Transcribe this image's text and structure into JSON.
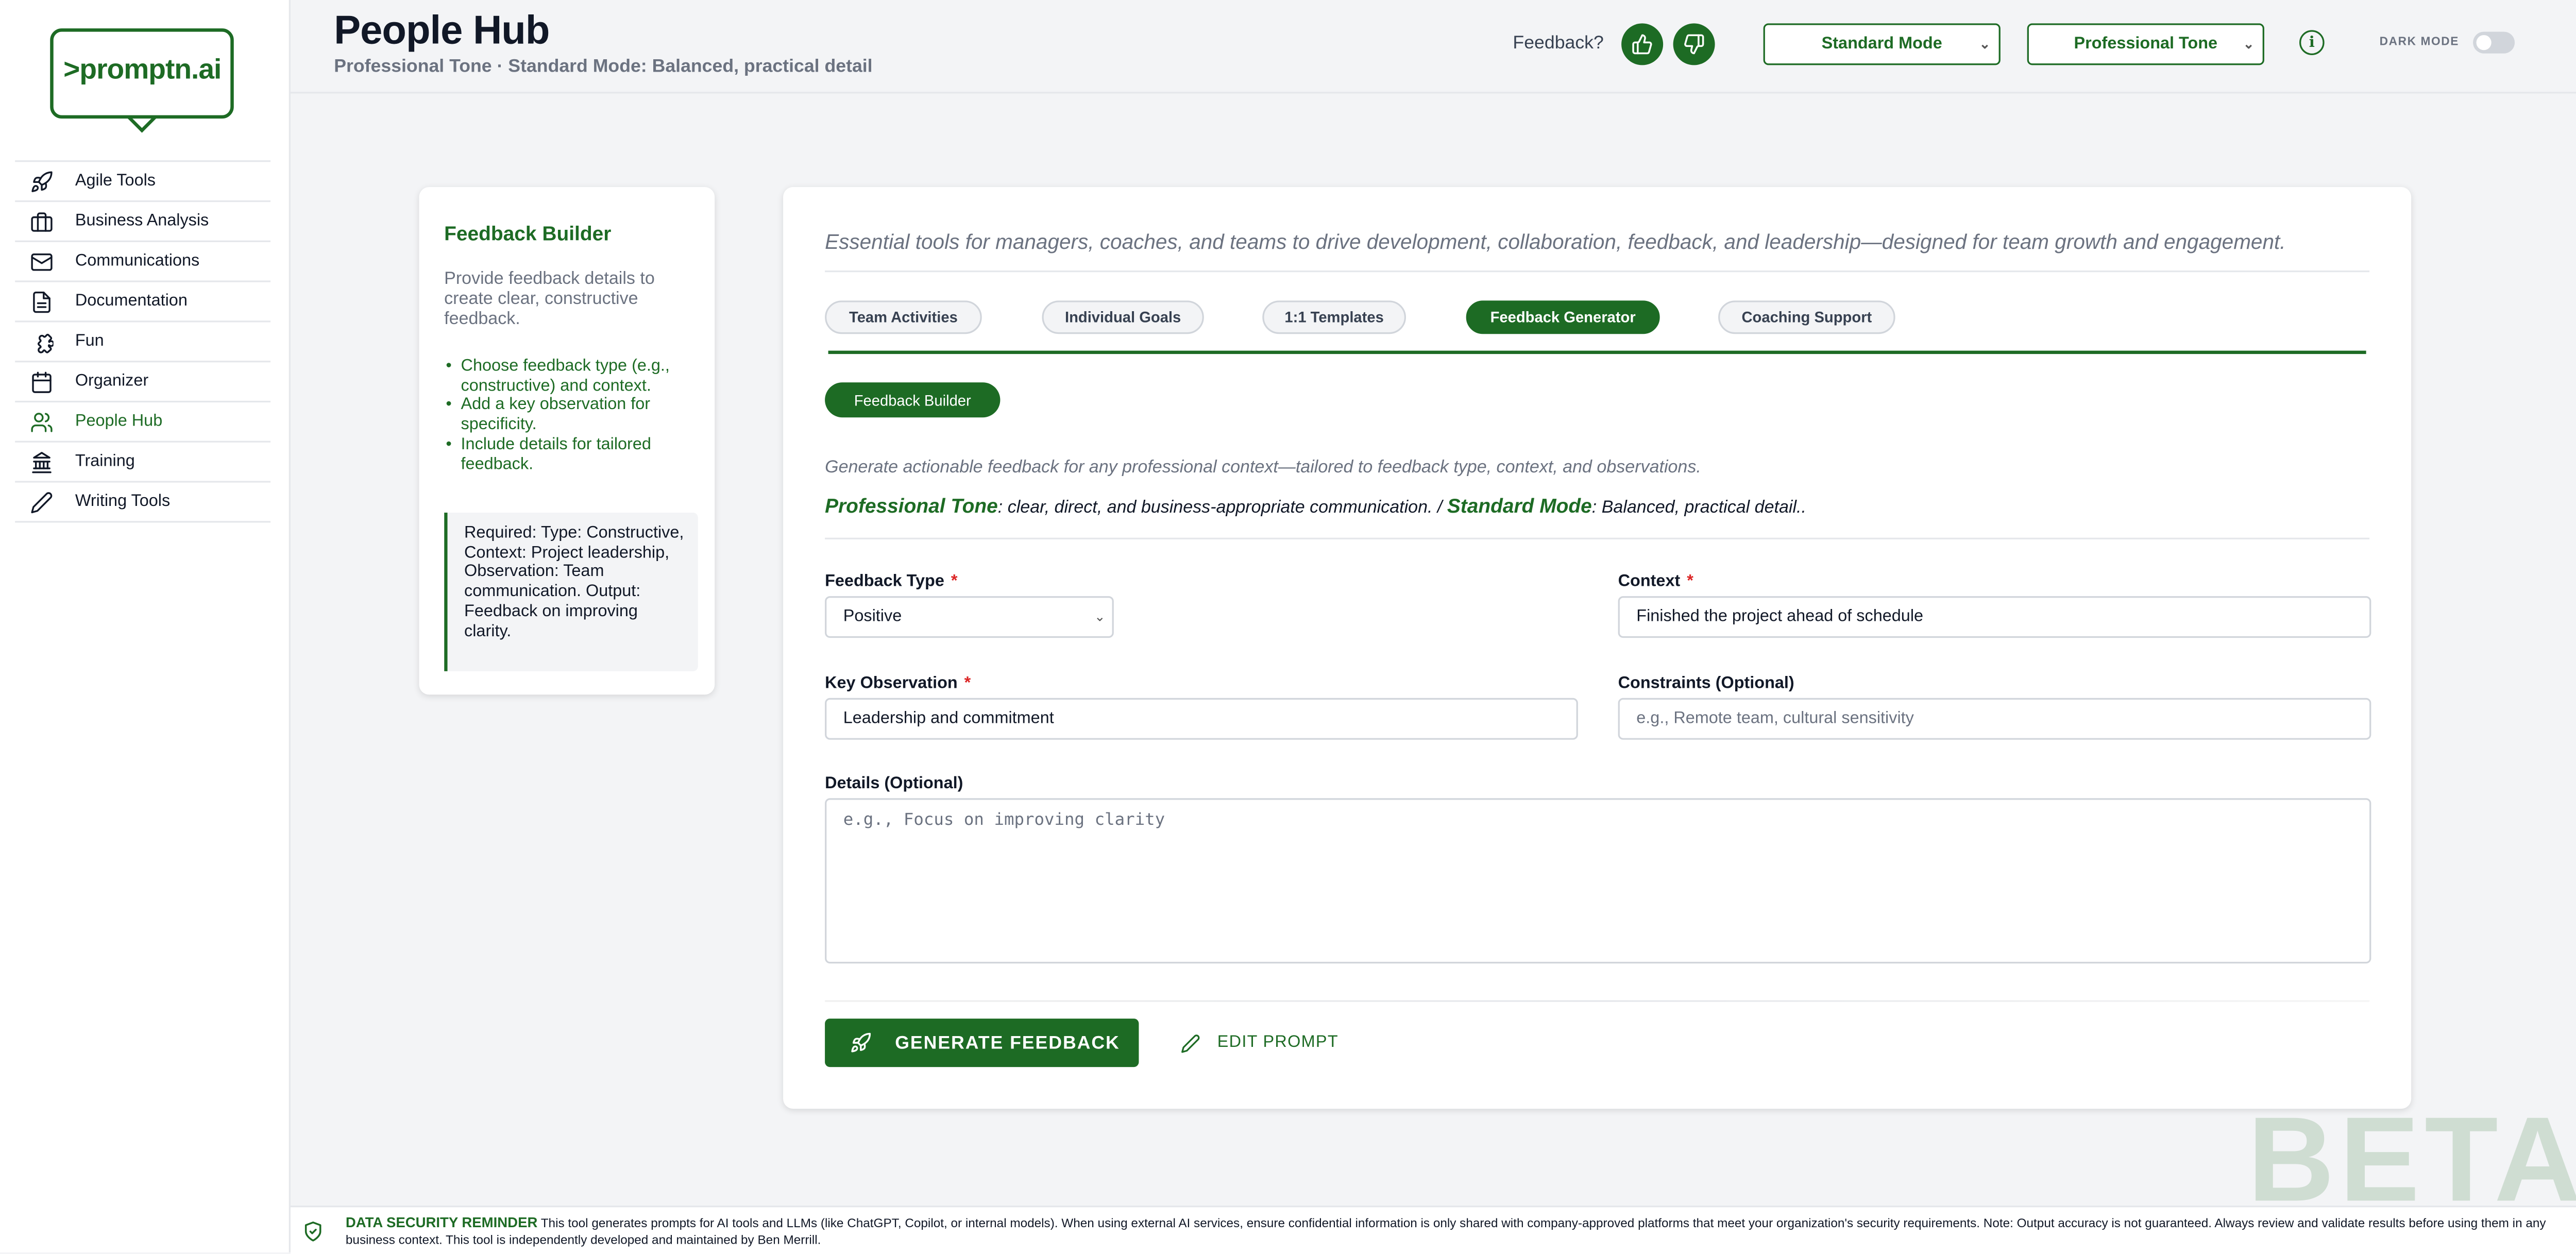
{
  "app": {
    "logo_text": "promptn.ai",
    "page_title": "People Hub",
    "page_subtitle": "Professional Tone · Standard Mode: Balanced, practical detail"
  },
  "sidebar": {
    "items": [
      {
        "label": "Agile Tools",
        "icon": "rocket-icon"
      },
      {
        "label": "Business Analysis",
        "icon": "briefcase-icon"
      },
      {
        "label": "Communications",
        "icon": "mail-icon"
      },
      {
        "label": "Documentation",
        "icon": "document-icon"
      },
      {
        "label": "Fun",
        "icon": "puzzle-icon"
      },
      {
        "label": "Organizer",
        "icon": "calendar-icon"
      },
      {
        "label": "People Hub",
        "icon": "users-icon",
        "active": true
      },
      {
        "label": "Training",
        "icon": "institution-icon"
      },
      {
        "label": "Writing Tools",
        "icon": "pencil-icon"
      }
    ]
  },
  "header": {
    "feedback_label": "Feedback?",
    "mode_select": "Standard Mode",
    "tone_select": "Professional Tone",
    "info_glyph": "i",
    "dark_mode_label": "DARK MODE",
    "dark_mode_on": false
  },
  "info_card": {
    "title": "Feedback Builder",
    "description": "Provide feedback details to create clear, constructive feedback.",
    "bullets": [
      "Choose feedback type (e.g., constructive) and context.",
      "Add a key observation for specificity.",
      "Include details for tailored feedback."
    ],
    "required_note": "Required: Type: Constructive, Context: Project leadership, Observation: Team communication. Output: Feedback on improving clarity."
  },
  "main": {
    "intro": "Essential tools for managers, coaches, and teams to drive development, collaboration, feedback, and leadership—designed for team growth and engagement.",
    "tabs": [
      {
        "label": "Team Activities"
      },
      {
        "label": "Individual Goals"
      },
      {
        "label": "1:1 Templates"
      },
      {
        "label": "Feedback Generator",
        "active": true
      },
      {
        "label": "Coaching Support"
      }
    ],
    "subtab": "Feedback Builder",
    "generator_description": "Generate actionable feedback for any professional context—tailored to feedback type, context, and observations.",
    "tone_name": "Professional Tone",
    "tone_text": ": clear, direct, and business-appropriate communication. / ",
    "mode_name": "Standard Mode",
    "mode_text": ": Balanced, practical detail..",
    "form": {
      "feedback_type_label": "Feedback Type",
      "feedback_type_value": "Positive",
      "context_label": "Context",
      "context_value": "Finished the project ahead of schedule",
      "key_observation_label": "Key Observation",
      "key_observation_value": "Leadership and commitment",
      "constraints_label": "Constraints (Optional)",
      "constraints_placeholder": "e.g., Remote team, cultural sensitivity",
      "details_label": "Details (Optional)",
      "details_placeholder": "e.g., Focus on improving clarity",
      "required_marker": "*"
    },
    "generate_button": "GENERATE FEEDBACK",
    "edit_button": "EDIT PROMPT"
  },
  "watermark": "BETA",
  "footer": {
    "title": "DATA SECURITY REMINDER",
    "text": "This tool generates prompts for AI tools and LLMs (like ChatGPT, Copilot, or internal models). When using external AI services, ensure confidential information is only shared with company-approved platforms that meet your organization's security requirements. Note: Output accuracy is not guaranteed. Always review and validate results before using them in any business context. This tool is independently developed and maintained by Ben Merrill."
  },
  "colors": {
    "brand": "#1d6b24",
    "required": "#dc2626",
    "background": "#f3f4f6"
  }
}
